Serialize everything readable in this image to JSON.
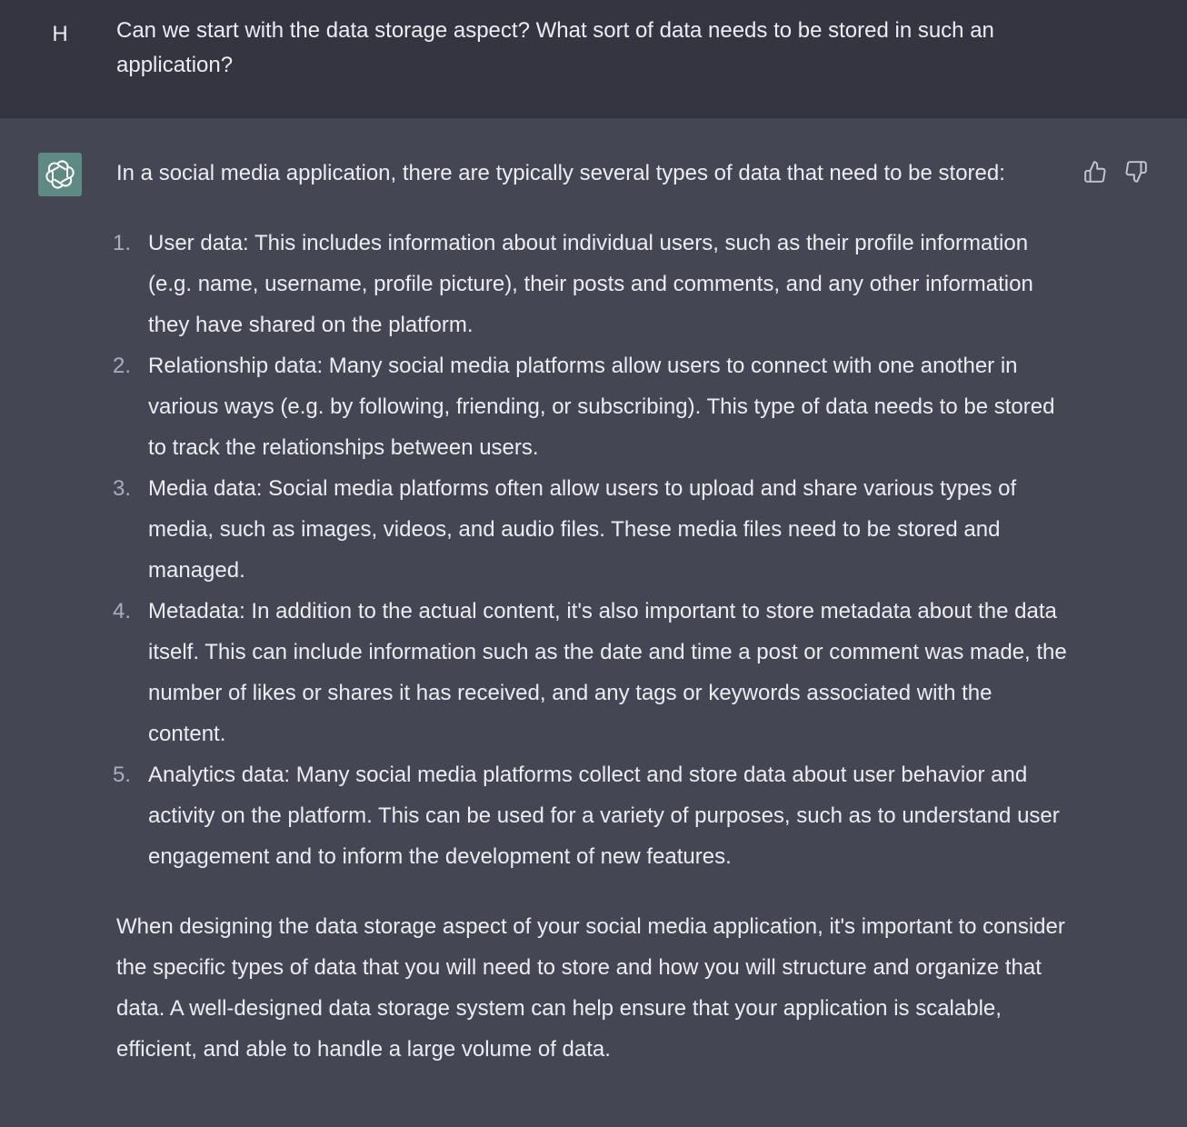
{
  "user": {
    "avatar_letter": "H",
    "message": "Can we start with the data storage aspect? What sort of data needs to be stored in such an application?"
  },
  "assistant": {
    "avatar_icon": "openai-logo-icon",
    "intro": "In a social media application, there are typically several types of data that need to be stored:",
    "items": [
      {
        "num": "1.",
        "text": "User data: This includes information about individual users, such as their profile information (e.g. name, username, profile picture), their posts and comments, and any other information they have shared on the platform."
      },
      {
        "num": "2.",
        "text": "Relationship data: Many social media platforms allow users to connect with one another in various ways (e.g. by following, friending, or subscribing). This type of data needs to be stored to track the relationships between users."
      },
      {
        "num": "3.",
        "text": "Media data: Social media platforms often allow users to upload and share various types of media, such as images, videos, and audio files. These media files need to be stored and managed."
      },
      {
        "num": "4.",
        "text": "Metadata: In addition to the actual content, it's also important to store metadata about the data itself. This can include information such as the date and time a post or comment was made, the number of likes or shares it has received, and any tags or keywords associated with the content."
      },
      {
        "num": "5.",
        "text": "Analytics data: Many social media platforms collect and store data about user behavior and activity on the platform. This can be used for a variety of purposes, such as to understand user engagement and to inform the development of new features."
      }
    ],
    "conclusion": "When designing the data storage aspect of your social media application, it's important to consider the specific types of data that you will need to store and how you will structure and organize that data. A well-designed data storage system can help ensure that your application is scalable, efficient, and able to handle a large volume of data."
  },
  "feedback": {
    "up_icon": "thumbs-up-icon",
    "down_icon": "thumbs-down-icon"
  },
  "colors": {
    "user_bg": "#343541",
    "assistant_bg": "#444654",
    "avatar_bg": "#5f8a83",
    "text": "#ececf1",
    "muted": "#acacbe"
  }
}
